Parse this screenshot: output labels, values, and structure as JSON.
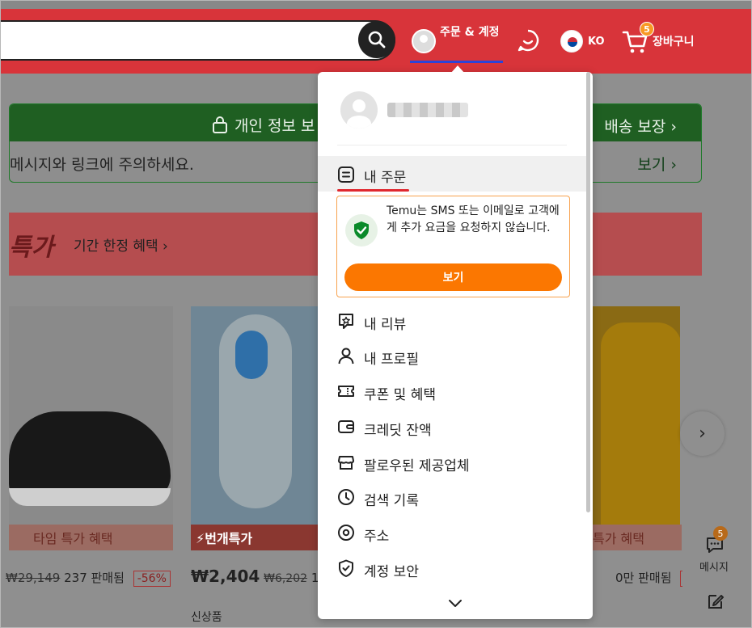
{
  "header": {
    "account_label": "주문 & 계정",
    "language_code": "KO",
    "cart_label": "장바구니",
    "cart_count": "5"
  },
  "background": {
    "banner_privacy": "개인 정보 보",
    "banner_delivery": "배송 보장 ›",
    "banner_message": "메시지와 링크에 주의하세요.",
    "banner_view": "보기 ›",
    "promo_title": "특가",
    "promo_subtitle": "기간 한정 혜택 ›",
    "tag_time_deal_1": "타임 특가 혜택",
    "tag_flash_deal": "⚡번개특가",
    "tag_time_deal_3": "특가 혜택",
    "product1_strike": "₩29,149",
    "product1_sold": "237 판매됨",
    "product1_pct": "-56%",
    "product2_price": "₩2,404",
    "product2_strike": "₩6,202",
    "product2_sold": "1.",
    "product3_sold": "0만 판매됨",
    "product3_pct": "-5",
    "new_item": "신상품",
    "side_message_label": "메시지",
    "side_message_count": "5"
  },
  "dropdown": {
    "my_orders": "내 주문",
    "notice_text": "Temu는 SMS 또는 이메일로 고객에게 추가 요금을 요청하지 않습니다.",
    "notice_button": "보기",
    "items": [
      {
        "label": "내 리뷰",
        "icon": "review-icon"
      },
      {
        "label": "내 프로필",
        "icon": "profile-icon"
      },
      {
        "label": "쿠폰 및 혜택",
        "icon": "coupon-icon"
      },
      {
        "label": "크레딧 잔액",
        "icon": "wallet-icon"
      },
      {
        "label": "팔로우된 제공업체",
        "icon": "store-icon"
      },
      {
        "label": "검색 기록",
        "icon": "clock-icon"
      },
      {
        "label": "주소",
        "icon": "location-icon"
      },
      {
        "label": "계정 보안",
        "icon": "shield-icon"
      }
    ]
  },
  "colors": {
    "header_red": "#d8343a",
    "accent_orange": "#fb7701",
    "active_underline_blue": "#2b43d9",
    "order_underline_red": "#e0282f",
    "shield_green": "#0a8a2a"
  }
}
